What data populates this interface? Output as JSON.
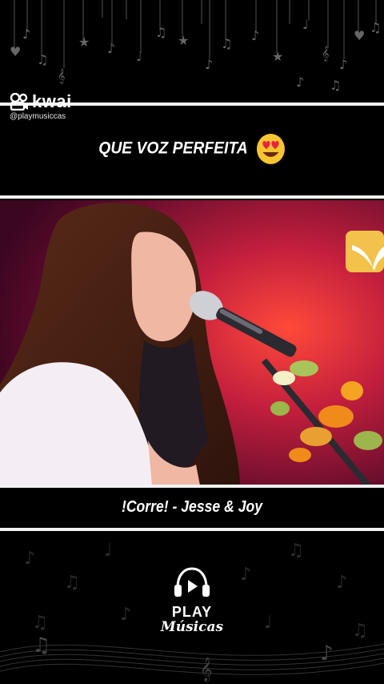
{
  "header": {
    "platform": "kwai",
    "handle": "@playmusiccas"
  },
  "caption": {
    "text": "QUE VOZ PERFEITA",
    "emoji_icon": "heart-eyes-emoji-icon"
  },
  "video": {
    "description_icon": "singer-with-microphone-video"
  },
  "song": {
    "title": "!Corre! - Jesse & Joy"
  },
  "brand": {
    "line1": "PLAY",
    "line2": "Músicas"
  },
  "colors": {
    "background": "#000000",
    "divider": "#f2f2f2",
    "text": "#ffffff",
    "stage_red": "#c41f3d",
    "emoji_yellow": "#f7c531"
  }
}
